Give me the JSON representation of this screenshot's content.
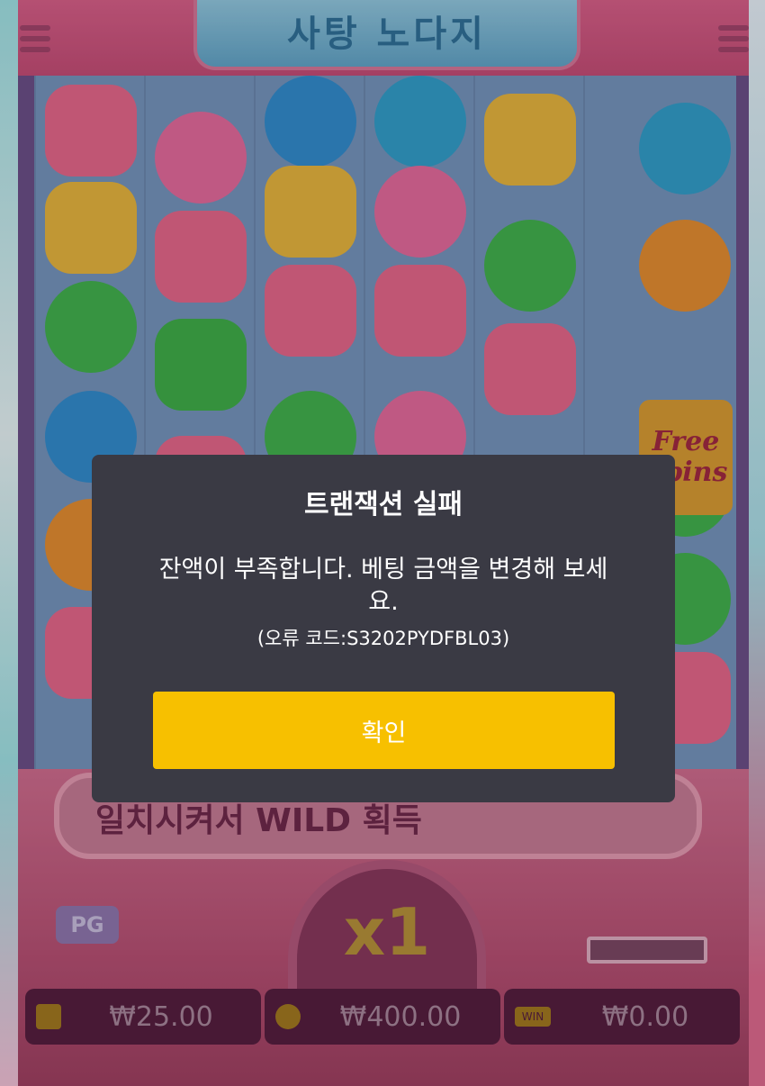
{
  "game": {
    "title": "사탕 노다지",
    "banner_text": "일치시켜서 WILD 획득",
    "multiplier": "x1",
    "badge": "PG",
    "free_spins_line1": "Free",
    "free_spins_line2": "Spins"
  },
  "stats": {
    "balance": "₩25.00",
    "bet": "₩400.00",
    "win": "₩0.00",
    "win_icon_label": "WIN"
  },
  "dialog": {
    "title": "트랜잭션 실패",
    "message": "잔액이 부족합니다. 베팅 금액을 변경해 보세요.",
    "error_code": "(오류 코드:S3202PYDFBL03)",
    "confirm_label": "확인"
  },
  "icons": [
    "menu-icon",
    "wallet-icon",
    "coins-icon",
    "win-icon"
  ],
  "colors": {
    "confirm_button": "#f7c000",
    "dialog_bg": "#3a3a44"
  }
}
